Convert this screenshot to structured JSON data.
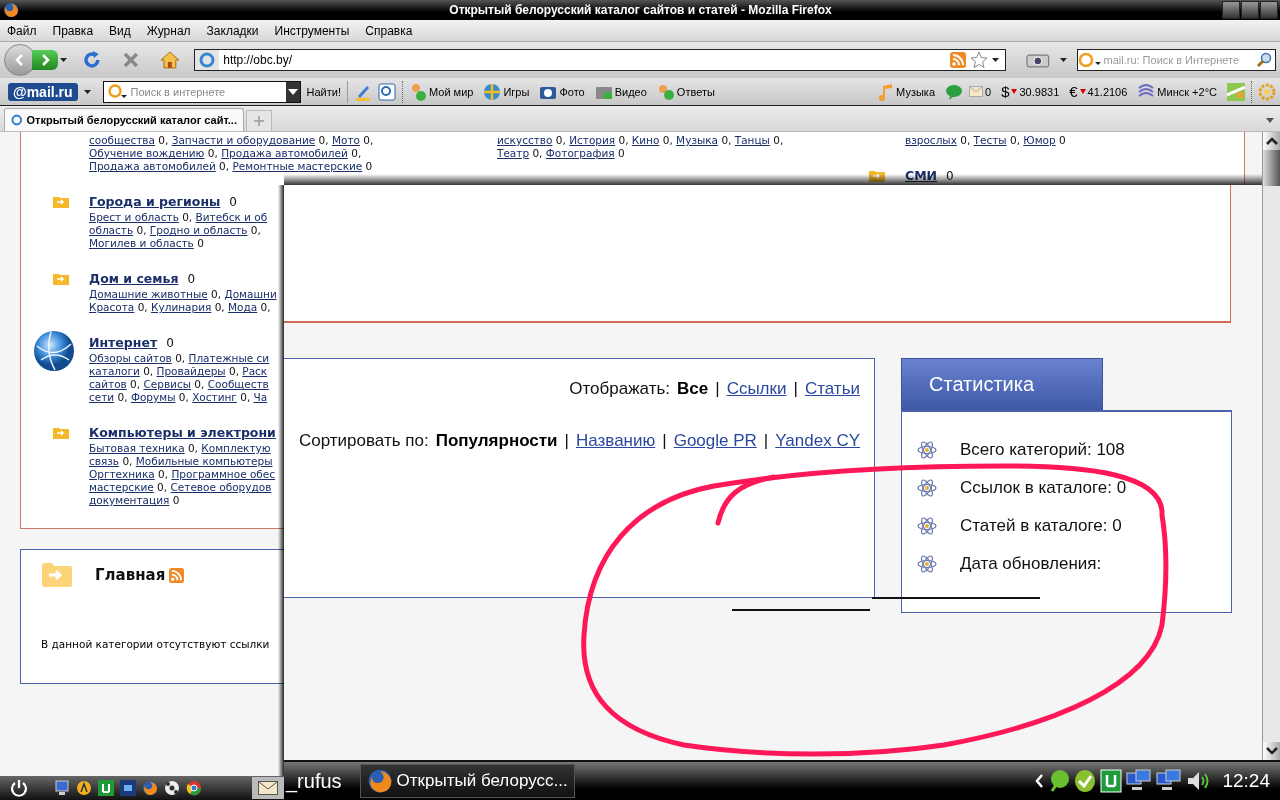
{
  "window": {
    "title": "Открытый белорусский каталог сайтов и статей - Mozilla Firefox"
  },
  "menu": [
    "Файл",
    "Правка",
    "Вид",
    "Журнал",
    "Закладки",
    "Инструменты",
    "Справка"
  ],
  "navigation": {
    "url": "http://obc.by/",
    "search_placeholder": "mail.ru: Поиск в Интернете"
  },
  "mail_toolbar": {
    "logo": "@mail.ru",
    "search_placeholder": "Поиск в интернете",
    "search_button": "Найти!",
    "links": [
      "Мой мир",
      "Игры",
      "Фото",
      "Видео",
      "Ответы"
    ],
    "music": "Музыка",
    "mail_count": "0",
    "usd_sign": "$",
    "usd": "30.9831",
    "eur_sign": "€",
    "eur": "41.2106",
    "weather": "Минск +2°C"
  },
  "tabs": [
    {
      "label": "Открытый белорусский каталог сайт...",
      "selected": true
    }
  ],
  "catalog": {
    "columns": [
      {
        "blocks": [
          {
            "kind": "continued",
            "lines": [
              [
                {
                  "link": "сообщества"
                },
                {
                  "text": " 0, "
                },
                {
                  "link": "Запчасти и оборудование"
                },
                {
                  "text": " 0, "
                },
                {
                  "link": "Мото"
                },
                {
                  "text": " 0,"
                }
              ],
              [
                {
                  "link": "Обучение вождению"
                },
                {
                  "text": " 0, "
                },
                {
                  "link": "Продажа автомобилей"
                },
                {
                  "text": " 0,"
                }
              ],
              [
                {
                  "link": "Продажа автомобилей"
                },
                {
                  "text": " 0, "
                },
                {
                  "link": "Ремонтные мастерские"
                },
                {
                  "text": " 0"
                }
              ]
            ]
          },
          {
            "kind": "plain",
            "title": "Города и регионы",
            "count": "0",
            "lines": [
              [
                {
                  "link": "Брест и область"
                },
                {
                  "text": " 0, "
                },
                {
                  "link": "Витебск и об"
                }
              ],
              [
                {
                  "link": "область"
                },
                {
                  "text": " 0, "
                },
                {
                  "link": "Гродно и область"
                },
                {
                  "text": " 0,"
                }
              ],
              [
                {
                  "link": "Могилев и область"
                },
                {
                  "text": " 0"
                }
              ]
            ]
          },
          {
            "kind": "plain",
            "title": "Дом и семья",
            "count": "0",
            "lines": [
              [
                {
                  "link": "Домашние животные"
                },
                {
                  "text": " 0, "
                },
                {
                  "link": "Домашни"
                }
              ],
              [
                {
                  "link": "Красота"
                },
                {
                  "text": " 0, "
                },
                {
                  "link": "Кулинария"
                },
                {
                  "text": " 0, "
                },
                {
                  "link": "Мода"
                },
                {
                  "text": " 0,"
                }
              ]
            ]
          },
          {
            "kind": "image",
            "title": "Интернет",
            "count": "0",
            "lines": [
              [
                {
                  "link": "Обзоры сайтов"
                },
                {
                  "text": " 0, "
                },
                {
                  "link": "Платежные си"
                }
              ],
              [
                {
                  "link": "каталоги"
                },
                {
                  "text": " 0, "
                },
                {
                  "link": "Провайдеры"
                },
                {
                  "text": " 0, "
                },
                {
                  "link": "Раск"
                }
              ],
              [
                {
                  "link": "сайтов"
                },
                {
                  "text": " 0, "
                },
                {
                  "link": "Сервисы"
                },
                {
                  "text": " 0, "
                },
                {
                  "link": "Сообществ"
                }
              ],
              [
                {
                  "link": "сети"
                },
                {
                  "text": " 0, "
                },
                {
                  "link": "Форумы"
                },
                {
                  "text": " 0, "
                },
                {
                  "link": "Хостинг"
                },
                {
                  "text": " 0, "
                },
                {
                  "link": "Ча"
                }
              ]
            ]
          },
          {
            "kind": "plain",
            "title": "Компьютеры и электрони",
            "lines": [
              [
                {
                  "link": "Бытовая техника"
                },
                {
                  "text": " 0, "
                },
                {
                  "link": "Комплектую"
                }
              ],
              [
                {
                  "link": "связь"
                },
                {
                  "text": " 0, "
                },
                {
                  "link": "Мобильные компьютеры"
                }
              ],
              [
                {
                  "link": "Оргтехника"
                },
                {
                  "text": " 0, "
                },
                {
                  "link": "Программное обес"
                }
              ],
              [
                {
                  "link": "мастерские"
                },
                {
                  "text": " 0, "
                },
                {
                  "link": "Сетевое оборудов"
                }
              ],
              [
                {
                  "link": "документация"
                },
                {
                  "text": " 0"
                }
              ]
            ]
          }
        ]
      },
      {
        "blocks": [
          {
            "kind": "continued",
            "lines": [
              [
                {
                  "link": "искусство"
                },
                {
                  "text": " 0, "
                },
                {
                  "link": "История"
                },
                {
                  "text": " 0, "
                },
                {
                  "link": "Кино"
                },
                {
                  "text": " 0, "
                },
                {
                  "link": "Музыка"
                },
                {
                  "text": " 0, "
                },
                {
                  "link": "Танцы"
                },
                {
                  "text": " 0,"
                }
              ],
              [
                {
                  "link": "Театр"
                },
                {
                  "text": " 0, "
                },
                {
                  "link": "Фотография"
                },
                {
                  "text": " 0"
                }
              ]
            ]
          }
        ]
      },
      {
        "blocks": [
          {
            "kind": "continued",
            "lines": [
              [
                {
                  "link": "взрослых"
                },
                {
                  "text": " 0, "
                },
                {
                  "link": "Тесты"
                },
                {
                  "text": " 0, "
                },
                {
                  "link": "Юмор"
                },
                {
                  "text": " 0"
                }
              ]
            ]
          },
          {
            "kind": "plain",
            "title": "СМИ",
            "count": "0"
          }
        ]
      }
    ]
  },
  "section": {
    "title": "Главная",
    "text": "В данной категории отсутствуют ссылки"
  },
  "zoomed": {
    "display": {
      "label": "Отображать:",
      "options": [
        {
          "label": "Все",
          "selected": true
        },
        {
          "separator": "|",
          "label": "Ссылки",
          "selected": false
        },
        {
          "separator": "|",
          "label": "Статьи",
          "selected": false
        }
      ]
    },
    "sort": {
      "label": "Сортировать по:",
      "options": [
        {
          "label": "Популярности",
          "selected": true
        },
        {
          "separator": "|",
          "label": "Названию",
          "selected": false
        },
        {
          "separator": "|",
          "label": "Google PR",
          "selected": false
        },
        {
          "separator": "|",
          "label": "Yandex CY",
          "selected": false
        }
      ]
    },
    "stats": {
      "tab": "Статистика",
      "items": [
        "Всего категорий: 108",
        "Ссылок в каталоге: 0",
        "Статей в каталоге: 0",
        "Дата обновления:"
      ]
    },
    "taskbar": {
      "user": "_rufus",
      "task": "Открытый белорусс...",
      "clock": "12:24"
    }
  }
}
